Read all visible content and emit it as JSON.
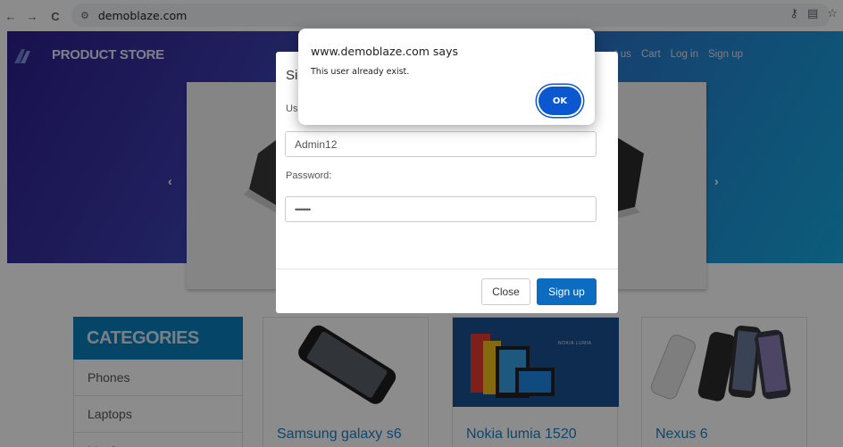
{
  "browser": {
    "url": "demoblaze.com",
    "nav": {
      "back": "←",
      "forward": "→",
      "reload": "C"
    }
  },
  "header": {
    "brand": "PRODUCT STORE",
    "nav": [
      "ut us",
      "Cart",
      "Log in",
      "Sign up"
    ]
  },
  "carousel": {
    "prev": "‹",
    "next": "›"
  },
  "categories": {
    "title": "CATEGORIES",
    "items": [
      "Phones",
      "Laptops",
      "Monitors"
    ]
  },
  "products": [
    {
      "title": "Samsung galaxy s6"
    },
    {
      "title": "Nokia lumia 1520",
      "badge": "NOKIA LUMIA"
    },
    {
      "title": "Nexus 6"
    }
  ],
  "signup_modal": {
    "title": "Si",
    "username_label": "Us",
    "username_value": "Admin12",
    "password_label": "Password:",
    "password_value": "••••••••",
    "close_label": "Close",
    "signup_label": "Sign up"
  },
  "alert": {
    "title": "www.demoblaze.com says",
    "message": "This user already exist.",
    "ok_label": "OK"
  },
  "colors": {
    "accent": "#0b57d0",
    "category_header": "#0a7ebd",
    "product_link": "#1f7fc2"
  }
}
